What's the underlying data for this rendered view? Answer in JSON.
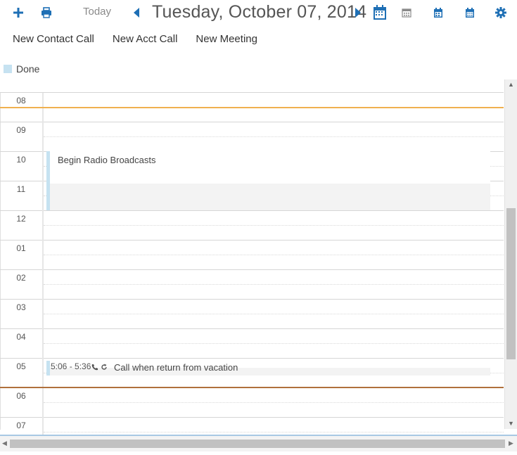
{
  "toolbar": {
    "add_icon": "plus-icon",
    "print_icon": "printer-icon",
    "today_label": "Today",
    "prev_icon": "caret-left-icon",
    "date_title": "Tuesday, October 07, 2014",
    "next_icon": "caret-right-icon",
    "view_icons": [
      "day-view-icon",
      "week-view-icon",
      "month-view-icon",
      "year-view-icon"
    ],
    "settings_icon": "gear-icon",
    "accent_color": "#1e6fb5"
  },
  "actions": [
    "New Contact Call",
    "New Acct Call",
    "New Meeting"
  ],
  "legend": {
    "label": "Done",
    "color": "#c6e2f1"
  },
  "calendar": {
    "hours": [
      "08",
      "09",
      "10",
      "11",
      "12",
      "01",
      "02",
      "03",
      "04",
      "05",
      "06",
      "07"
    ],
    "events": [
      {
        "title": "Begin Radio Broadcasts"
      },
      {
        "time": "5:06 - 5:36",
        "title": "Call when return from vacation",
        "icons": [
          "phone-icon",
          "recurring-icon"
        ]
      }
    ]
  }
}
